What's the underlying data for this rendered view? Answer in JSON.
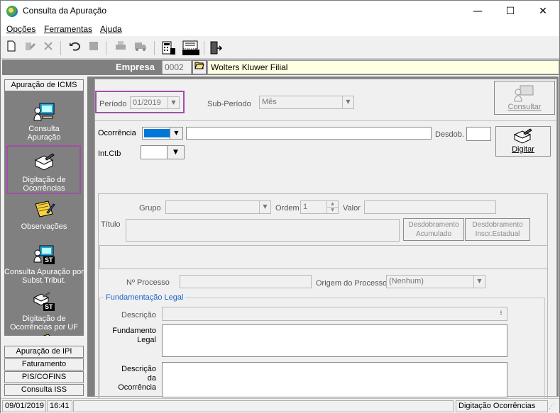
{
  "window": {
    "title": "Consulta da Apuração",
    "controls": {
      "minimize": "—",
      "maximize": "☐",
      "close": "✕"
    }
  },
  "menu": [
    {
      "label": "Opções"
    },
    {
      "label": "Ferramentas"
    },
    {
      "label": "Ajuda"
    }
  ],
  "toolbar": {
    "icons": [
      "new-icon",
      "edit-icon",
      "delete-icon",
      "undo-icon",
      "stop-icon",
      "print-icon",
      "truck-icon",
      "calculator-icon",
      "dirf-icon",
      "exit-icon"
    ],
    "dirf_label": "DIRF"
  },
  "empresa": {
    "label": "Empresa",
    "code": "0002",
    "name": "Wolters Kluwer Filial"
  },
  "sidebar": {
    "groups": [
      "Apuração de ICMS",
      "Apuração de IPI",
      "Faturamento",
      "PIS/COFINS",
      "Consulta ISS"
    ],
    "items": [
      {
        "label": "Consulta Apuração"
      },
      {
        "label": "Digitação de Ocorrências"
      },
      {
        "label": "Observações"
      },
      {
        "label": "Consulta Apuração por Subst.Tribut."
      },
      {
        "label": "Digitação de Ocorrências por UF"
      }
    ],
    "st_badge": "ST"
  },
  "form": {
    "periodo_label": "Período",
    "periodo_value": "01/2019",
    "subperiodo_label": "Sub-Período",
    "subperiodo_value": "Mês",
    "consultar_label": "Consultar",
    "ocorrencia_label": "Ocorrência",
    "desdob_label": "Desdob.",
    "digitar_label": "Digitar",
    "intctb_label": "Int.Ctb",
    "grupo_label": "Grupo",
    "ordem_label": "Ordem",
    "ordem_value": "1",
    "valor_label": "Valor",
    "titulo_label": "Título",
    "desdobramento_acumulado": "Desdobramento Acumulado",
    "desdobramento_inscr": "Desdobramento Inscr.Estadual",
    "nprocesso_label": "Nº Processo",
    "origem_label": "Origem do Processo",
    "origem_value": "(Nenhum)",
    "fundamentacao_group": "Fundamentação Legal",
    "descricao_label": "Descrição",
    "fundamento_label": "Fundamento Legal",
    "descricao_ocorrencia_label": "Descrição da Ocorrência"
  },
  "status": {
    "date": "09/01/2019",
    "time": "16:41",
    "screen": "Digitação Ocorrências"
  },
  "colors": {
    "highlight": "#a050a8",
    "empresa_bar": "#808080",
    "empresa_name_bg": "#ffffe1",
    "selection": "#0078d7"
  }
}
